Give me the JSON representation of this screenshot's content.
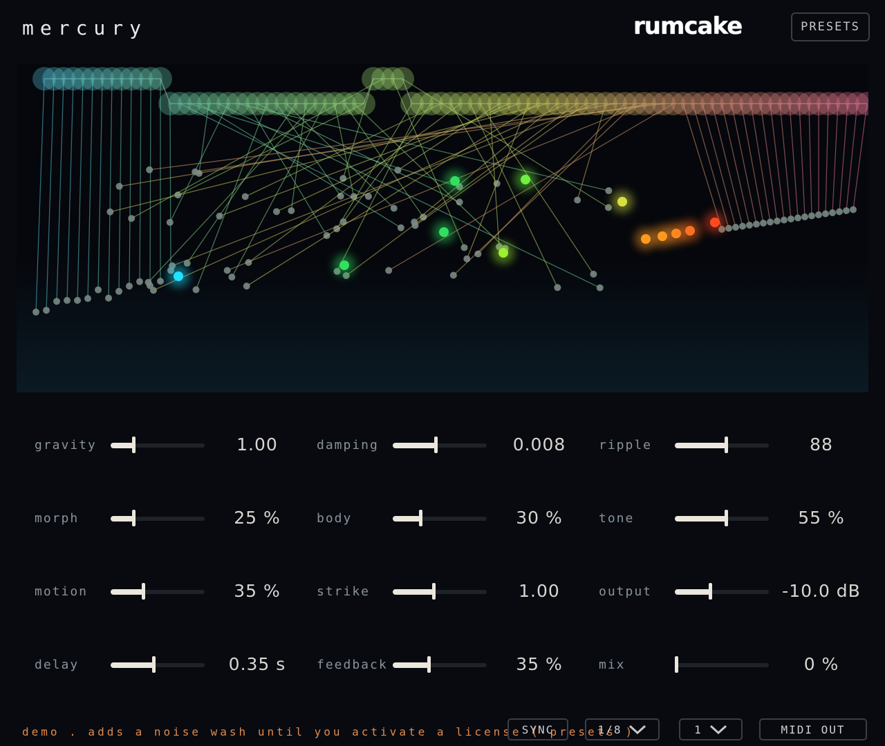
{
  "app": {
    "title": "mercury",
    "brand": "rumcake",
    "presets_label": "PRESETS"
  },
  "params": [
    {
      "id": "gravity",
      "label": "gravity",
      "value": "1.00",
      "level": 0.25,
      "col": 0,
      "row": 0
    },
    {
      "id": "damping",
      "label": "damping",
      "value": "0.008",
      "level": 0.46,
      "col": 1,
      "row": 0
    },
    {
      "id": "ripple",
      "label": "ripple",
      "value": "88",
      "level": 0.55,
      "col": 2,
      "row": 0
    },
    {
      "id": "morph",
      "label": "morph",
      "value": "25 %",
      "level": 0.25,
      "col": 0,
      "row": 1
    },
    {
      "id": "body",
      "label": "body",
      "value": "30 %",
      "level": 0.3,
      "col": 1,
      "row": 1
    },
    {
      "id": "tone",
      "label": "tone",
      "value": "55 %",
      "level": 0.55,
      "col": 2,
      "row": 1
    },
    {
      "id": "motion",
      "label": "motion",
      "value": "35 %",
      "level": 0.35,
      "col": 0,
      "row": 2
    },
    {
      "id": "strike",
      "label": "strike",
      "value": "1.00",
      "level": 0.44,
      "col": 1,
      "row": 2
    },
    {
      "id": "output",
      "label": "output",
      "value": "-10.0 dB",
      "level": 0.38,
      "col": 2,
      "row": 2
    },
    {
      "id": "delay",
      "label": "delay",
      "value": "0.35 s",
      "level": 0.46,
      "col": 0,
      "row": 3
    },
    {
      "id": "feedback",
      "label": "feedback",
      "value": "35 %",
      "level": 0.39,
      "col": 1,
      "row": 3
    },
    {
      "id": "mix",
      "label": "mix",
      "value": "0 %",
      "level": 0.0,
      "col": 2,
      "row": 3
    }
  ],
  "footer": {
    "demo_text": "demo  .  adds a noise wash until you activate a license  ( presets )",
    "sync_label": "SYNC",
    "division_value": "1/8",
    "count_value": "1",
    "midi_out_label": "MIDI OUT"
  },
  "colors": {
    "accent": "#e08a4e",
    "slider": "#ebe7dc",
    "background": "#080a10"
  }
}
